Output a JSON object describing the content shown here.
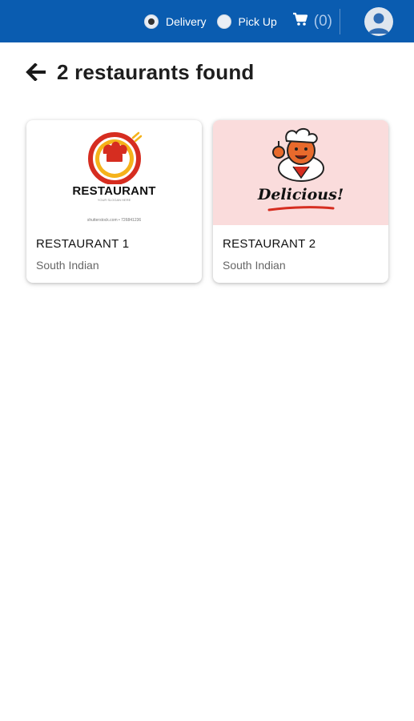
{
  "topbar": {
    "delivery_label": "Delivery",
    "pickup_label": "Pick Up",
    "cart_count": "(0)",
    "selected_mode": "Delivery"
  },
  "results": {
    "title": "2 restaurants found"
  },
  "restaurants": [
    {
      "name": "RESTAURANT 1",
      "cuisine": "South Indian",
      "logo_text": "RESTAURANT",
      "logo_subtext": "YOUR SLOGAN HERE",
      "logo_footer": "shutterstock.com • 726841236"
    },
    {
      "name": "RESTAURANT 2",
      "cuisine": "South Indian",
      "logo_text": "Delicious!"
    }
  ],
  "colors": {
    "topbar": "#0a5cb0",
    "card2_image_bg": "#fadcdc",
    "logo_red": "#d62d20"
  }
}
